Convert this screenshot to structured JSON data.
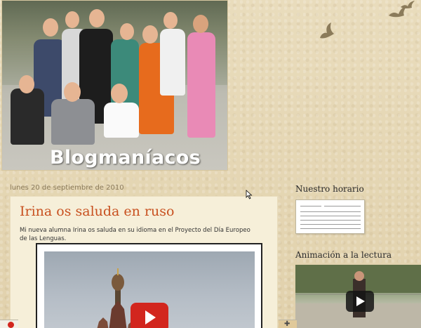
{
  "blog": {
    "title": "Blogmaníacos"
  },
  "post": {
    "date": "lunes 20 de septiembre de 2010",
    "title": "Irina os saluda en ruso",
    "body": "Mi nueva alumna Irina os saluda en su idioma en el Proyecto del Día Europeo de las Lenguas."
  },
  "sidebar": {
    "schedule_title": "Nuestro horario",
    "reading_title": "Animación a la lectura"
  },
  "colors": {
    "background": "#e6d7b6",
    "post_title": "#c8501f",
    "date": "#8a7a5a",
    "post_bg": "#f6efd9",
    "youtube_red": "#d2261e"
  },
  "icons": {
    "birds": "bird-icon",
    "play": "play-icon",
    "cursor": "mouse-cursor-icon",
    "expand": "plus-icon"
  }
}
